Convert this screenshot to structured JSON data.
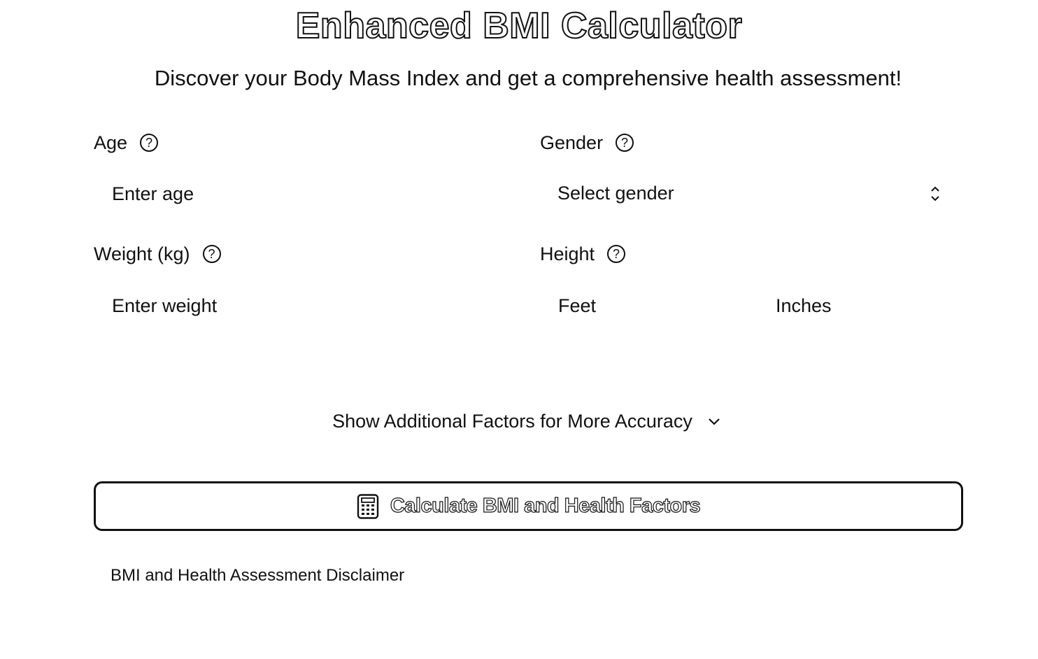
{
  "header": {
    "title": "Enhanced BMI Calculator",
    "subtitle": "Discover your Body Mass Index and get a comprehensive health assessment!"
  },
  "form": {
    "age": {
      "label": "Age",
      "placeholder": "Enter age",
      "help_icon": "question-circle-icon"
    },
    "gender": {
      "label": "Gender",
      "selected": "Select gender",
      "help_icon": "question-circle-icon"
    },
    "weight": {
      "label": "Weight (kg)",
      "placeholder": "Enter weight",
      "help_icon": "question-circle-icon"
    },
    "height": {
      "label": "Height",
      "feet_placeholder": "Feet",
      "inches_placeholder": "Inches",
      "help_icon": "question-circle-icon"
    }
  },
  "additional_factors": {
    "label": "Show Additional Factors for More Accuracy",
    "icon": "chevron-down-icon"
  },
  "calculate_button": {
    "label": "Calculate BMI and Health Factors",
    "icon": "calculator-icon"
  },
  "disclaimer": {
    "label": "BMI and Health Assessment Disclaimer"
  },
  "colors": {
    "text": "#111111",
    "background": "#ffffff"
  }
}
